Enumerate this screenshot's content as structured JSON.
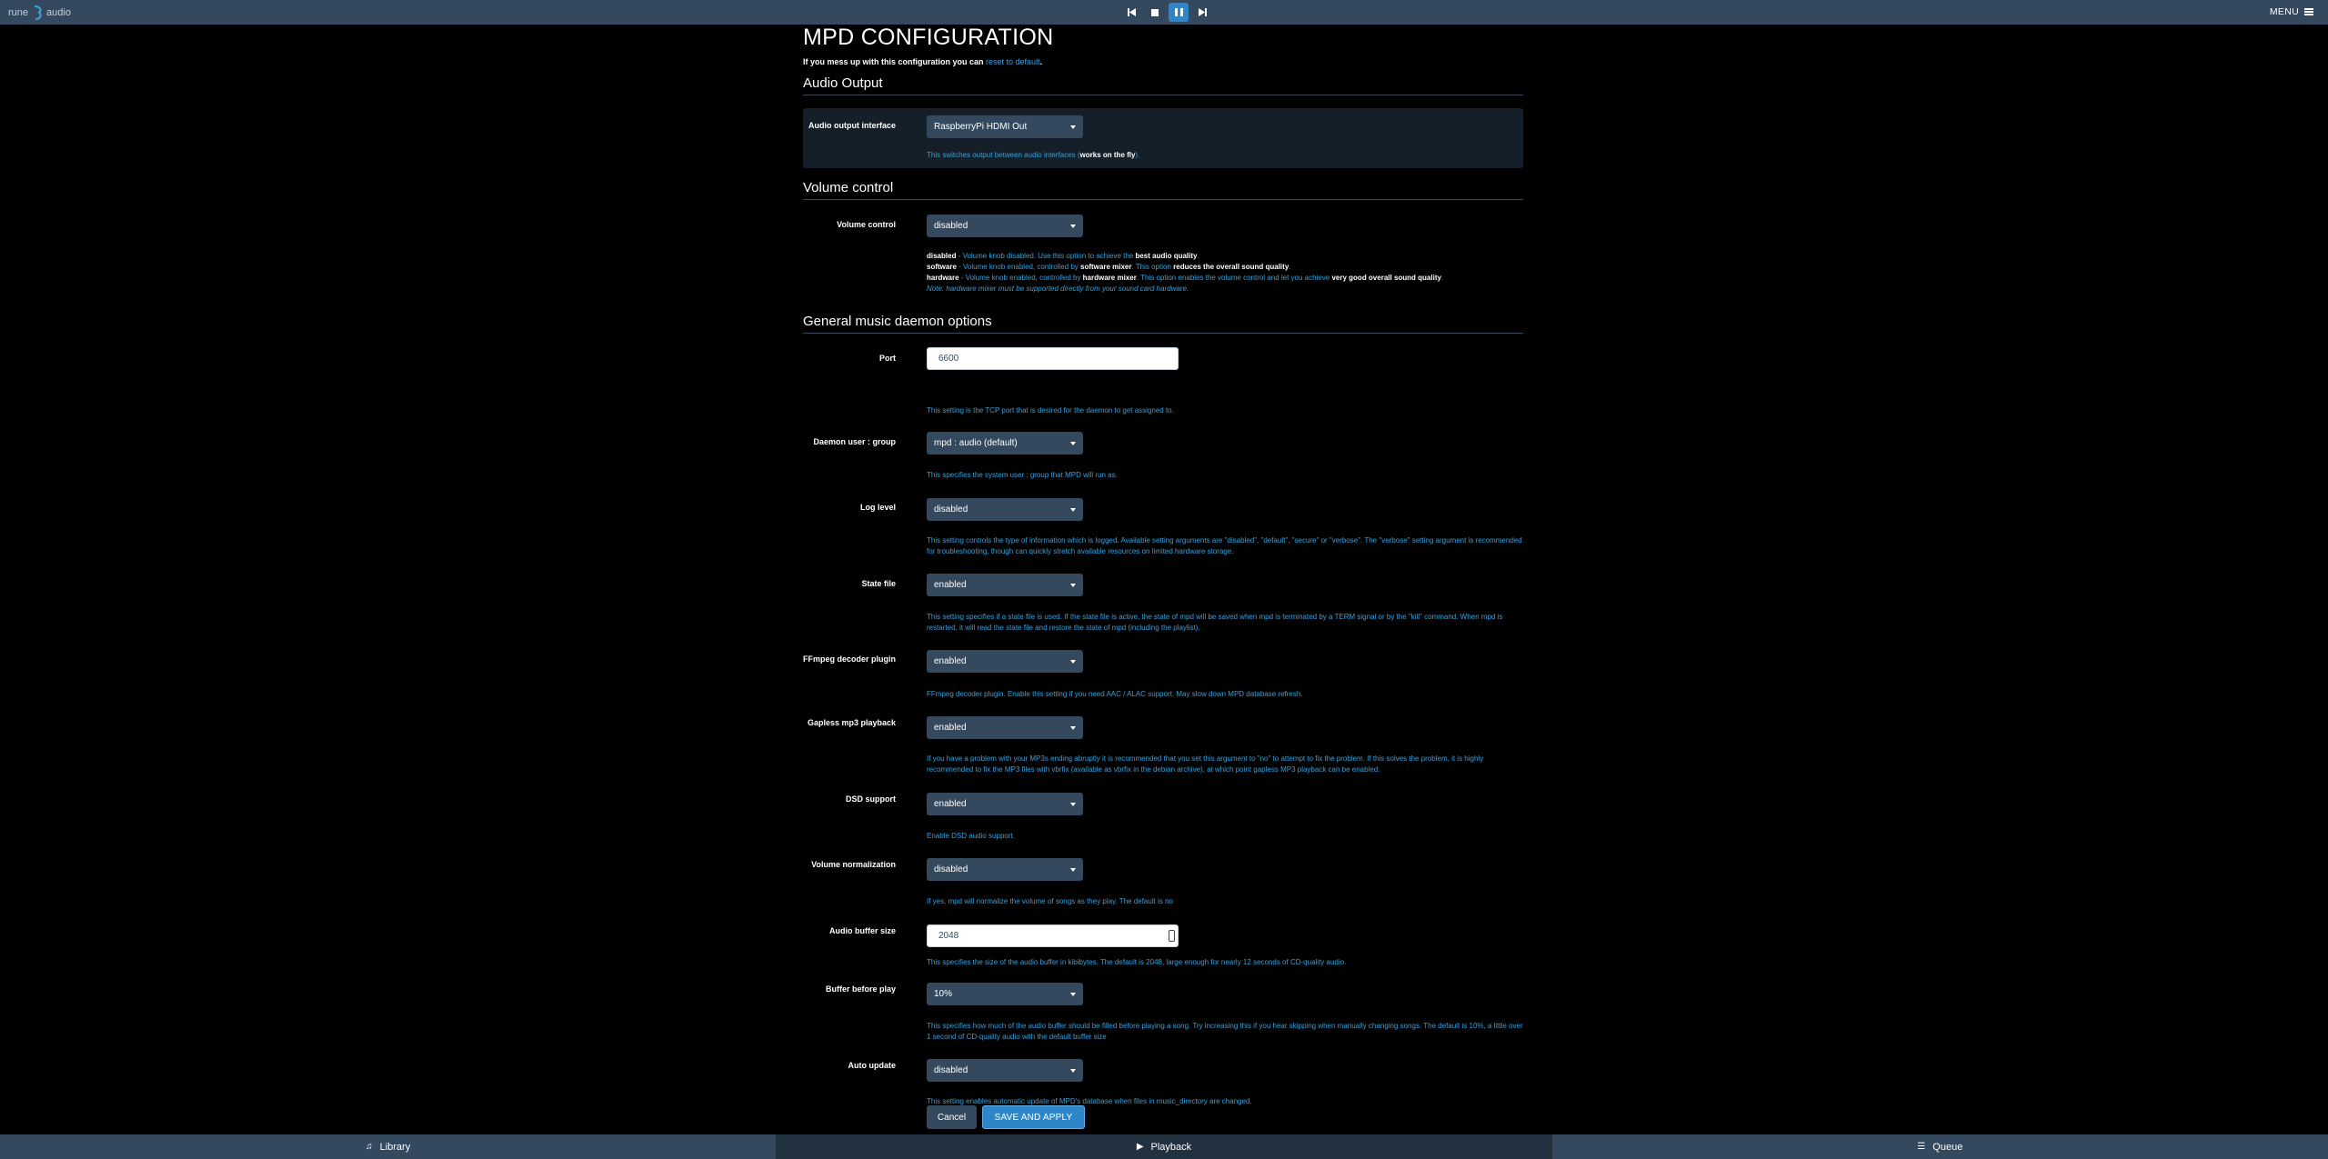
{
  "topbar": {
    "logo_left": "rune",
    "logo_right": "audio",
    "menu_label": "MENU"
  },
  "page": {
    "title": "MPD CONFIGURATION",
    "intro_text": "If you mess up with this configuration you can",
    "reset_link": "reset to default",
    "intro_end": "."
  },
  "audio_output": {
    "legend": "Audio Output",
    "label": "Audio output interface",
    "value": "RaspberryPi HDMI Out",
    "help_pre": "This switches output between audio interfaces (",
    "help_bold": "works on the fly",
    "help_post": ")."
  },
  "volume": {
    "legend": "Volume control",
    "label": "Volume control",
    "value": "disabled",
    "l1_a": "disabled",
    "l1_b": " - Volume knob disabled. Use this option to achieve the ",
    "l1_c": "best audio quality",
    "l1_d": ".",
    "l2_a": "software",
    "l2_b": " - Volume knob enabled, controlled by ",
    "l2_c": "software mixer",
    "l2_d": ". This option ",
    "l2_e": "reduces the overall sound quality",
    "l2_f": ".",
    "l3_a": "hardware",
    "l3_b": " - Volume knob enabled, controlled by ",
    "l3_c": "hardware mixer",
    "l3_d": ". This option enables the volume control and let you achieve ",
    "l3_e": "very good overall sound quality",
    "l3_f": ".",
    "note": "Note: hardware mixer must be supported directly from your sound card hardware."
  },
  "general": {
    "legend": "General music daemon options",
    "port": {
      "label": "Port",
      "value": "6600",
      "help": "This setting is the TCP port that is desired for the daemon to get assigned to."
    },
    "user": {
      "label": "Daemon user : group",
      "value": "mpd : audio (default)",
      "help": "This specifies the system user : group that MPD will run as."
    },
    "log": {
      "label": "Log level",
      "value": "disabled",
      "help": "This setting controls the type of information which is logged. Available setting arguments are \"disabled\", \"default\", \"secure\" or \"verbose\". The \"verbose\" setting argument is recommended for troubleshooting, though can quickly stretch available resources on limited hardware storage."
    },
    "state": {
      "label": "State file",
      "value": "enabled",
      "help": "This setting specifies if a state file is used. If the state file is active, the state of mpd will be saved when mpd is terminated by a TERM signal or by the \"kill\" command. When mpd is restarted, it will read the state file and restore the state of mpd (including the playlist)."
    },
    "ffmpeg": {
      "label": "FFmpeg decoder plugin",
      "value": "enabled",
      "help": "FFmpeg decoder plugin. Enable this setting if you need AAC / ALAC support. May slow down MPD database refresh."
    },
    "gapless": {
      "label": "Gapless mp3 playback",
      "value": "enabled",
      "help": "If you have a problem with your MP3s ending abruptly it is recommended that you set this argument to \"no\" to attempt to fix the problem. If this solves the problem, it is highly recommended to fix the MP3 files with vbrfix (available as vbrfix in the debian archive), at which point gapless MP3 playback can be enabled."
    },
    "dsd": {
      "label": "DSD support",
      "value": "enabled",
      "help": "Enable DSD audio support."
    },
    "norm": {
      "label": "Volume normalization",
      "value": "disabled",
      "help": "If yes, mpd will normalize the volume of songs as they play. The default is no"
    },
    "buffer": {
      "label": "Audio buffer size",
      "value": "2048",
      "help": "This specifies the size of the audio buffer in kibibytes. The default is 2048, large enough for nearly 12 seconds of CD-quality audio."
    },
    "before": {
      "label": "Buffer before play",
      "value": "10%",
      "help": "This specifies how much of the audio buffer should be filled before playing a song. Try increasing this if you hear skipping when manually changing songs. The default is 10%, a little over 1 second of CD-quality audio with the default buffer size"
    },
    "auto": {
      "label": "Auto update",
      "value": "disabled",
      "help": "This setting enables automatic update of MPD's database when files in music_directory are changed."
    }
  },
  "buttons": {
    "cancel": "Cancel",
    "save": "SAVE AND APPLY"
  },
  "bottombar": {
    "library": "Library",
    "playback": "Playback",
    "queue": "Queue"
  },
  "colors": {
    "bar": "#34495e",
    "accent": "#2e86c9",
    "help_text": "#3a9fd9"
  }
}
